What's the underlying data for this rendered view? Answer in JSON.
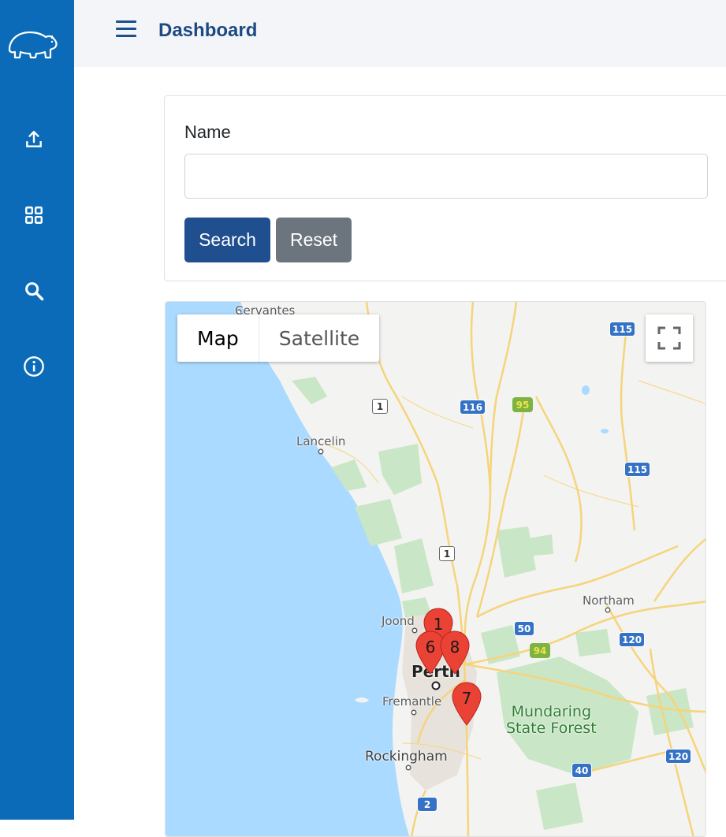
{
  "header": {
    "title": "Dashboard"
  },
  "sidebar": {
    "logo": "bear-logo",
    "items": [
      {
        "icon": "upload-icon"
      },
      {
        "icon": "dashboard-grid-icon"
      },
      {
        "icon": "search-icon"
      },
      {
        "icon": "info-icon"
      }
    ]
  },
  "search_form": {
    "name_label": "Name",
    "name_value": "",
    "name_placeholder": "",
    "search_label": "Search",
    "reset_label": "Reset"
  },
  "map": {
    "type_map_label": "Map",
    "type_satellite_label": "Satellite",
    "places": {
      "cervantes": "Cervantes",
      "lancelin": "Lancelin",
      "northam": "Northam",
      "joondalup": "Joond",
      "perth": "Perth",
      "fremantle": "Fremantle",
      "mundaring": "Mundaring\nState Forest",
      "rockingham": "Rockingham"
    },
    "routes": [
      "115",
      "116",
      "95",
      "1",
      "115",
      "1",
      "50",
      "94",
      "120",
      "40",
      "120",
      "2"
    ],
    "markers": [
      "1",
      "6",
      "8",
      "7"
    ],
    "colors": {
      "water": "#aadaff",
      "land": "#f3f3f1",
      "park": "#c8e6c9",
      "road": "#f5d77a",
      "marker": "#ea4335"
    }
  }
}
